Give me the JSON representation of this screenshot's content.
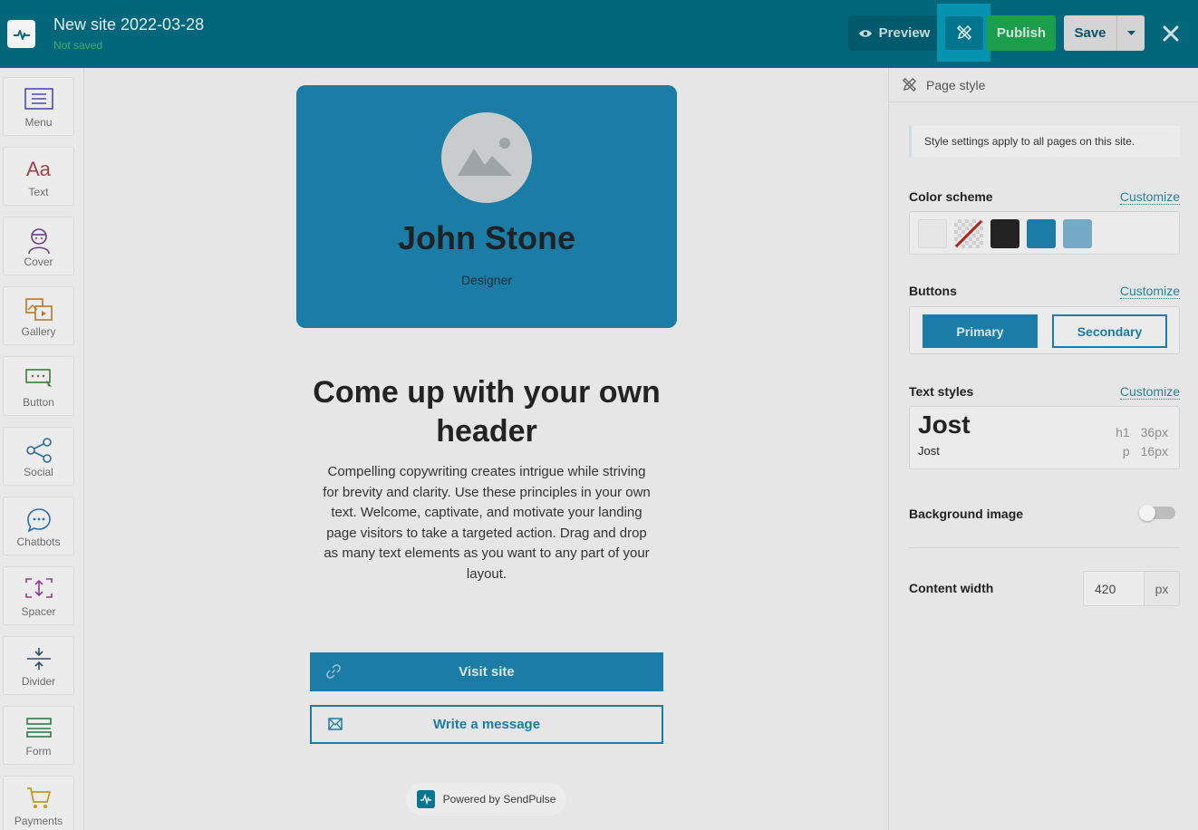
{
  "header": {
    "title": "New site 2022-03-28",
    "status": "Not saved",
    "preview_label": "Preview",
    "publish_label": "Publish",
    "save_label": "Save"
  },
  "tools": [
    {
      "label": "Menu",
      "icon": "menu-icon"
    },
    {
      "label": "Text",
      "icon": "text-icon"
    },
    {
      "label": "Cover",
      "icon": "cover-icon"
    },
    {
      "label": "Gallery",
      "icon": "gallery-icon"
    },
    {
      "label": "Button",
      "icon": "button-icon"
    },
    {
      "label": "Social",
      "icon": "share-icon"
    },
    {
      "label": "Chatbots",
      "icon": "chat-icon"
    },
    {
      "label": "Spacer",
      "icon": "spacer-icon"
    },
    {
      "label": "Divider",
      "icon": "divider-icon"
    },
    {
      "label": "Form",
      "icon": "form-icon"
    },
    {
      "label": "Payments",
      "icon": "cart-icon"
    }
  ],
  "page": {
    "name": "John Stone",
    "role": "Designer",
    "headline": "Come up with your own header",
    "body": "Compelling copywriting creates intrigue while striving for brevity and clarity. Use these principles in your own text. Welcome, captivate, and motivate your landing page visitors to take a targeted action. Drag and drop as many text elements as you want to any part of your layout.",
    "visit_label": "Visit site",
    "write_label": "Write a message",
    "powered_label": "Powered by SendPulse"
  },
  "panel": {
    "title": "Page style",
    "info": "Style settings apply to all pages on this site.",
    "color_scheme_title": "Color scheme",
    "customize_label": "Customize",
    "swatches": [
      "#e6e6e6",
      "transparent",
      "#222222",
      "#1b7ca6",
      "#76a9c3"
    ],
    "buttons_title": "Buttons",
    "primary_label": "Primary",
    "secondary_label": "Secondary",
    "text_styles_title": "Text styles",
    "font_name": "Jost",
    "h1_tag": "h1",
    "h1_size": "36px",
    "p_tag": "p",
    "p_size": "16px",
    "background_image_title": "Background image",
    "background_image_on": false,
    "content_width_title": "Content width",
    "content_width_value": "420",
    "content_width_unit": "px"
  }
}
